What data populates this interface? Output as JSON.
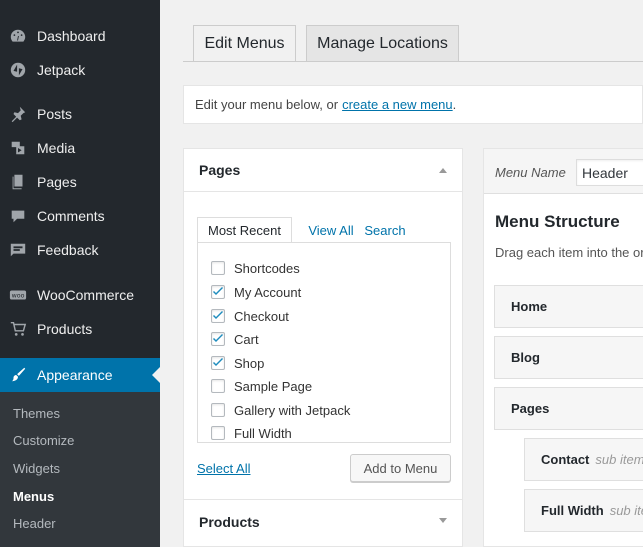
{
  "sidebar": {
    "items": [
      {
        "label": "Dashboard",
        "icon": "dashboard-icon"
      },
      {
        "label": "Jetpack",
        "icon": "jetpack-icon"
      },
      {
        "label": "Posts",
        "icon": "pin-icon"
      },
      {
        "label": "Media",
        "icon": "media-icon"
      },
      {
        "label": "Pages",
        "icon": "pages-icon"
      },
      {
        "label": "Comments",
        "icon": "comment-icon"
      },
      {
        "label": "Feedback",
        "icon": "feedback-icon"
      },
      {
        "label": "WooCommerce",
        "icon": "woocommerce-icon",
        "badge": "woo"
      },
      {
        "label": "Products",
        "icon": "cart-icon"
      },
      {
        "label": "Appearance",
        "icon": "brush-icon"
      }
    ],
    "submenu": [
      "Themes",
      "Customize",
      "Widgets",
      "Menus",
      "Header"
    ],
    "active_color": "#0073aa"
  },
  "tabs": {
    "edit_menus": "Edit Menus",
    "manage_locations": "Manage Locations"
  },
  "notice": {
    "text": "Edit your menu below, or",
    "link": "create a new menu",
    "suffix": "."
  },
  "pages_box": {
    "title": "Pages",
    "tabs": [
      "Most Recent",
      "View All",
      "Search"
    ],
    "items": [
      {
        "label": "Shortcodes",
        "checked": false
      },
      {
        "label": "My Account",
        "checked": true
      },
      {
        "label": "Checkout",
        "checked": true
      },
      {
        "label": "Cart",
        "checked": true
      },
      {
        "label": "Shop",
        "checked": true
      },
      {
        "label": "Sample Page",
        "checked": false
      },
      {
        "label": "Gallery with Jetpack",
        "checked": false
      },
      {
        "label": "Full Width",
        "checked": false
      }
    ],
    "select_all": "Select All",
    "add_button": "Add to Menu"
  },
  "products_box": {
    "title": "Products"
  },
  "menu_panel": {
    "name_label": "Menu Name",
    "name_value": "Header",
    "structure_title": "Menu Structure",
    "instructions": "Drag each item into the order you prefer.",
    "items": [
      {
        "label": "Home",
        "sub": ""
      },
      {
        "label": "Blog",
        "sub": ""
      },
      {
        "label": "Pages",
        "sub": ""
      },
      {
        "label": "Contact",
        "sub": "sub item"
      },
      {
        "label": "Full Width",
        "sub": "sub item"
      }
    ]
  }
}
